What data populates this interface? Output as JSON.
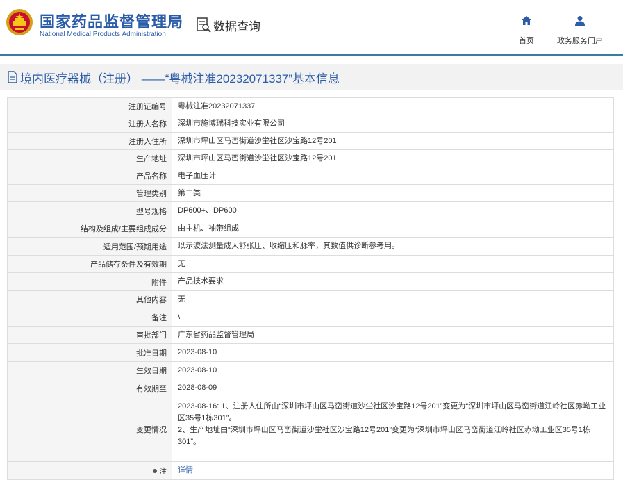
{
  "header": {
    "logo_cn": "国家药品监督管理局",
    "logo_en": "National Medical Products Administration",
    "query_label": "数据查询",
    "nav": [
      {
        "label": "首页",
        "icon": "home-icon"
      },
      {
        "label": "政务服务门户",
        "icon": "user-icon"
      }
    ],
    "accent": "#2a5ca8"
  },
  "page": {
    "title": "境内医疗器械（注册） ——“粤械注准20232071337”基本信息"
  },
  "rows": [
    {
      "label": "注册证编号",
      "value": "粤械注准20232071337"
    },
    {
      "label": "注册人名称",
      "value": "深圳市施博瑞科技实业有限公司"
    },
    {
      "label": "注册人住所",
      "value": "深圳市坪山区马峦街道沙坣社区沙宝路12号201"
    },
    {
      "label": "生产地址",
      "value": "深圳市坪山区马峦街道沙坣社区沙宝路12号201"
    },
    {
      "label": "产品名称",
      "value": "电子血压计"
    },
    {
      "label": "管理类别",
      "value": "第二类"
    },
    {
      "label": "型号规格",
      "value": "DP600+、DP600"
    },
    {
      "label": "结构及组成/主要组成成分",
      "value": "由主机、袖带组成"
    },
    {
      "label": "适用范围/预期用途",
      "value": "以示波法测量成人舒张压、收缩压和脉率，其数值供诊断参考用。"
    },
    {
      "label": "产品储存条件及有效期",
      "value": "无"
    },
    {
      "label": "附件",
      "value": "产品技术要求"
    },
    {
      "label": "其他内容",
      "value": "无"
    },
    {
      "label": "备注",
      "value": "\\"
    },
    {
      "label": "审批部门",
      "value": "广东省药品监督管理局"
    },
    {
      "label": "批准日期",
      "value": "2023-08-10"
    },
    {
      "label": "生效日期",
      "value": "2023-08-10"
    },
    {
      "label": "有效期至",
      "value": "2028-08-09"
    },
    {
      "label": "变更情况",
      "value": "2023-08-16: 1、注册人住所由“深圳市坪山区马峦街道沙坣社区沙宝路12号201”变更为“深圳市坪山区马峦街道江岭社区赤坳工业区35号1栋301”。\n2、生产地址由“深圳市坪山区马峦街道沙坣社区沙宝路12号201”变更为“深圳市坪山区马峦街道江岭社区赤坳工业区35号1栋301”。"
    },
    {
      "label": "注",
      "value": "详情"
    }
  ]
}
